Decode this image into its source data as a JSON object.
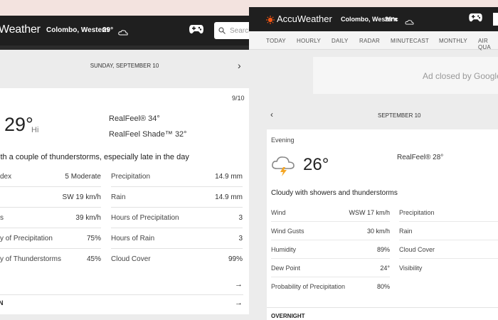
{
  "left": {
    "brand": "Weather",
    "location": "Colombo, Western",
    "header_temp": "29°",
    "search_placeholder": "Search",
    "day_label": "SUNDAY, SEPTEMBER 10",
    "date": "9/10",
    "temp": "29°",
    "hi_label": "Hi",
    "realfeel": "RealFeel® 34°",
    "realfeel_shade": "RealFeel Shade™ 32°",
    "phrase": "ith a couple of thunderstorms, especially late in the day",
    "rows_left": [
      {
        "label": "dex",
        "value": "5 Moderate"
      },
      {
        "label": "",
        "value": "SW 19 km/h"
      },
      {
        "label": "s",
        "value": "39 km/h"
      },
      {
        "label": "y of Precipitation",
        "value": "75%"
      },
      {
        "label": "y of Thunderstorms",
        "value": "45%"
      }
    ],
    "rows_right": [
      {
        "label": "Precipitation",
        "value": "14.9 mm"
      },
      {
        "label": "Rain",
        "value": "14.9 mm"
      },
      {
        "label": "Hours of Precipitation",
        "value": "3"
      },
      {
        "label": "Hours of Rain",
        "value": "3"
      },
      {
        "label": "Cloud Cover",
        "value": "99%"
      }
    ],
    "arrow": "→",
    "last_label": "N"
  },
  "right": {
    "brand": "AccuWeather",
    "location": "Colombo, Western",
    "header_temp": "29°c",
    "nav": [
      "TODAY",
      "HOURLY",
      "DAILY",
      "RADAR",
      "MINUTECAST",
      "MONTHLY",
      "AIR QUA"
    ],
    "ad_text": "Ad closed by Google",
    "date_label": "SEPTEMBER 10",
    "period": "Evening",
    "temp": "26°",
    "realfeel": "RealFeel® 28°",
    "phrase": "Cloudy with showers and thunderstorms",
    "rows_left": [
      {
        "label": "Wind",
        "value": "WSW 17 km/h"
      },
      {
        "label": "Wind Gusts",
        "value": "30 km/h"
      },
      {
        "label": "Humidity",
        "value": "89%"
      },
      {
        "label": "Dew Point",
        "value": "24°"
      },
      {
        "label": "Probability of Precipitation",
        "value": "80%"
      }
    ],
    "rows_right": [
      {
        "label": "Precipitation"
      },
      {
        "label": "Rain"
      },
      {
        "label": "Cloud Cover"
      },
      {
        "label": "Visibility"
      }
    ],
    "overnight": "OVERNIGHT"
  },
  "colors": {
    "header": "#1f1f1f",
    "accent": "#f05514",
    "background": "#f4e4e0"
  }
}
